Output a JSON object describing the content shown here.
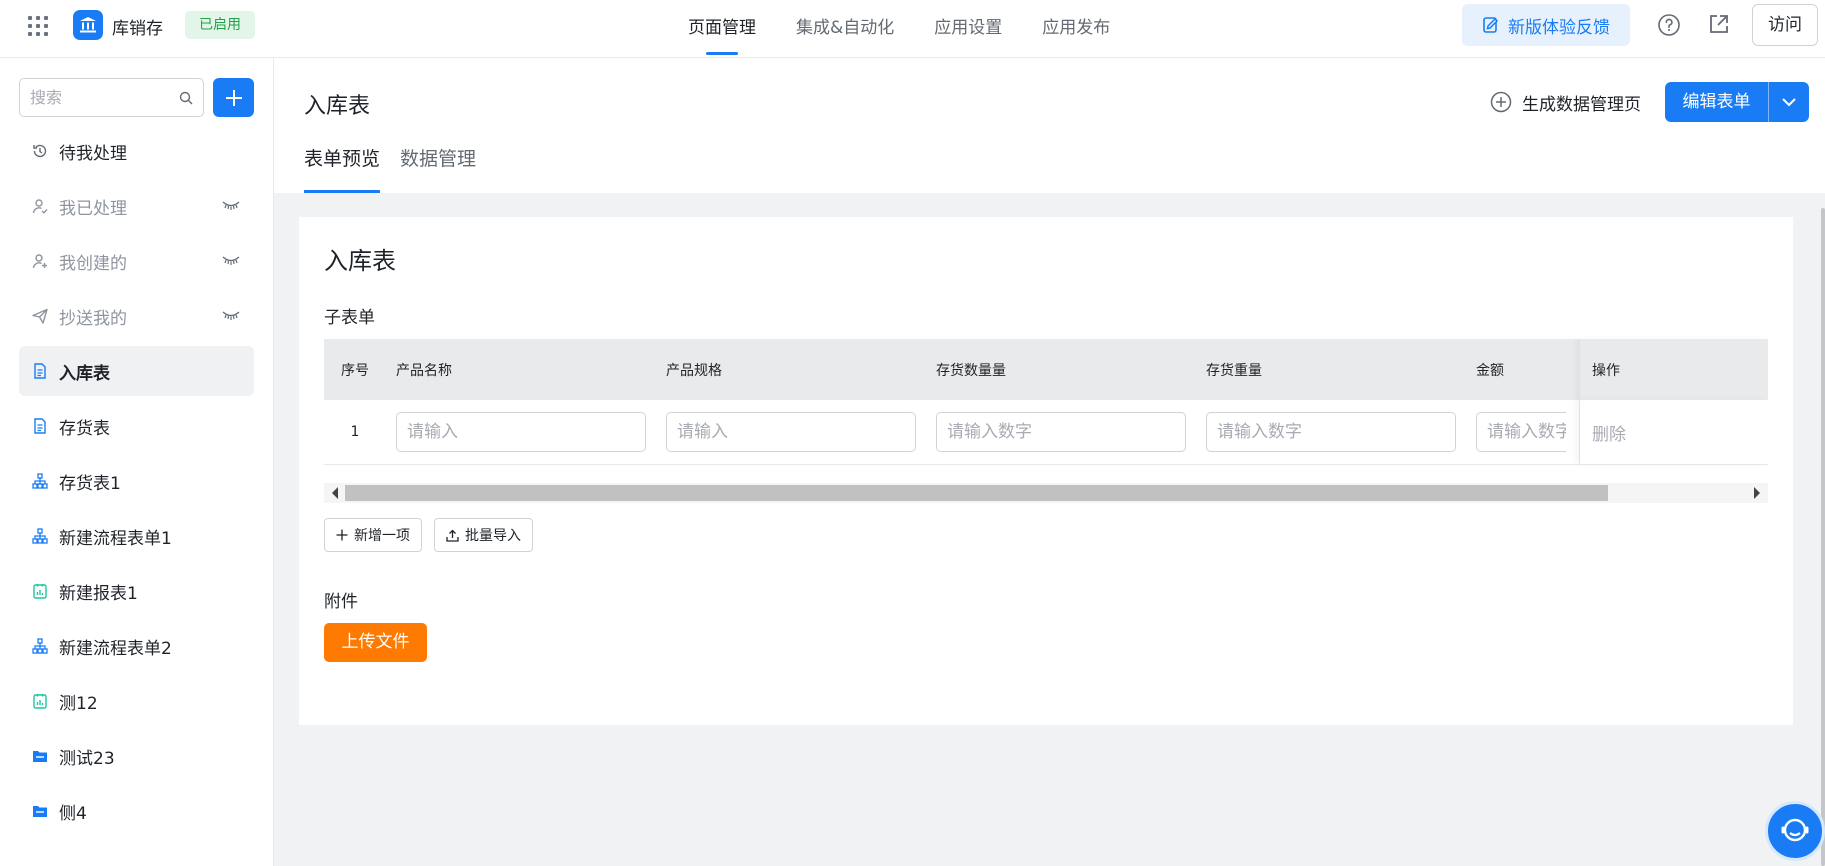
{
  "topbar": {
    "app_name": "库销存",
    "status_badge": "已启用",
    "nav": [
      {
        "label": "页面管理",
        "active": true
      },
      {
        "label": "集成&自动化",
        "active": false
      },
      {
        "label": "应用设置",
        "active": false
      },
      {
        "label": "应用发布",
        "active": false
      }
    ],
    "feedback_label": "新版体验反馈",
    "visit_label": "访问",
    "accent_color": "#1a7cf4"
  },
  "sidebar": {
    "search_placeholder": "搜索",
    "items": [
      {
        "label": "待我处理",
        "icon": "clock-icon",
        "muted": false,
        "hidden": false
      },
      {
        "label": "我已处理",
        "icon": "user-check-icon",
        "muted": true,
        "hidden": true
      },
      {
        "label": "我创建的",
        "icon": "user-add-icon",
        "muted": true,
        "hidden": true
      },
      {
        "label": "抄送我的",
        "icon": "send-icon",
        "muted": true,
        "hidden": true
      },
      {
        "label": "入库表",
        "icon": "form-doc-icon",
        "muted": false,
        "hidden": false,
        "active": true
      },
      {
        "label": "存货表",
        "icon": "form-doc-icon",
        "muted": false,
        "hidden": false
      },
      {
        "label": "存货表1",
        "icon": "flow-icon",
        "muted": false,
        "hidden": false
      },
      {
        "label": "新建流程表单1",
        "icon": "flow-icon",
        "muted": false,
        "hidden": false
      },
      {
        "label": "新建报表1",
        "icon": "report-icon",
        "muted": false,
        "hidden": false
      },
      {
        "label": "新建流程表单2",
        "icon": "flow-icon",
        "muted": false,
        "hidden": false
      },
      {
        "label": "测12",
        "icon": "report-icon",
        "muted": false,
        "hidden": false
      },
      {
        "label": "测试23",
        "icon": "folder-icon",
        "muted": false,
        "hidden": false
      },
      {
        "label": "侧4",
        "icon": "folder-icon",
        "muted": false,
        "hidden": false
      }
    ]
  },
  "main": {
    "page_title": "入库表",
    "generate_label": "生成数据管理页",
    "edit_label": "编辑表单",
    "tabs": [
      {
        "label": "表单预览",
        "active": true
      },
      {
        "label": "数据管理",
        "active": false
      }
    ]
  },
  "form": {
    "title": "入库表",
    "subform_label": "子表单",
    "columns": [
      "序号",
      "产品名称",
      "产品规格",
      "存货数量量",
      "存货重量",
      "金额",
      "操作"
    ],
    "row": {
      "index": "1",
      "placeholders": [
        "请输入",
        "请输入",
        "请输入数字",
        "请输入数字",
        "请输入数字"
      ],
      "delete_label": "删除"
    },
    "add_item_label": "新增一项",
    "batch_import_label": "批量导入",
    "attachment_label": "附件",
    "upload_label": "上传文件",
    "upload_color": "#ff7a00"
  }
}
